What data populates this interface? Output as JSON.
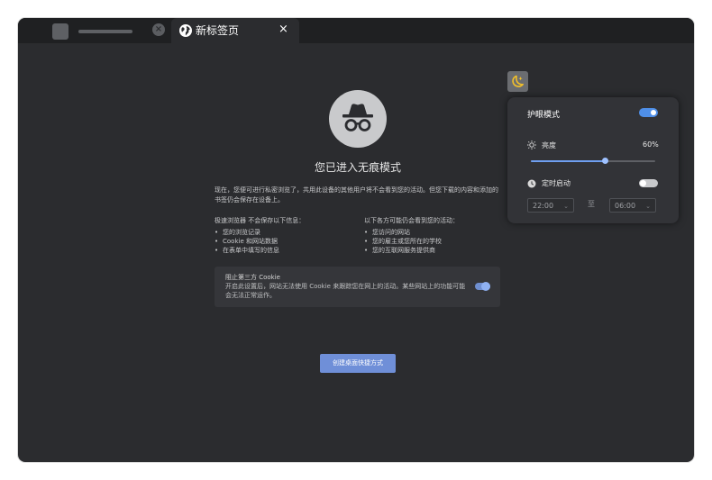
{
  "tabs": {
    "active_title": "新标签页",
    "active_close": "×",
    "inactive_close": "×"
  },
  "incognito": {
    "heading": "您已进入无痕模式",
    "intro": "现在，您便可进行私密浏览了，共用此设备的其他用户将不会看到您的活动。但您下载的内容和添加的书签仍会保存在设备上。",
    "left_title": "极速浏览器 不会保存以下信息：",
    "left_items": [
      "您的浏览记录",
      "Cookie 和网站数据",
      "在表单中填写的信息"
    ],
    "right_title": "以下各方可能仍会看到您的活动：",
    "right_items": [
      "您访问的网站",
      "您的雇主或您所在的学校",
      "您的互联网服务提供商"
    ],
    "cookie_title": "阻止第三方 Cookie",
    "cookie_desc": "开启此设置后，网站无法使用 Cookie 来跟踪您在网上的活动。某些网站上的功能可能会无法正常运作。",
    "cookie_block_enabled": true,
    "shortcut_button": "创建桌面快捷方式"
  },
  "eye_panel": {
    "title": "护眼模式",
    "enabled": true,
    "brightness_label": "亮度",
    "brightness_value": "60%",
    "brightness_fraction": 0.6,
    "timer_label": "定时启动",
    "timer_enabled": false,
    "start_time": "22:00",
    "to_label": "至",
    "end_time": "06:00"
  },
  "icons": [
    "globe-icon",
    "close-icon",
    "incognito-icon",
    "moon-icon",
    "sun-icon",
    "clock-icon",
    "chevron-down-icon"
  ],
  "colors": {
    "window_bg": "#2b2c2f",
    "tabbar_bg": "#1f2022",
    "accent_blue": "#4f8fe8",
    "button_blue": "#6f8fd8",
    "moon_yellow": "#f2c02a"
  }
}
